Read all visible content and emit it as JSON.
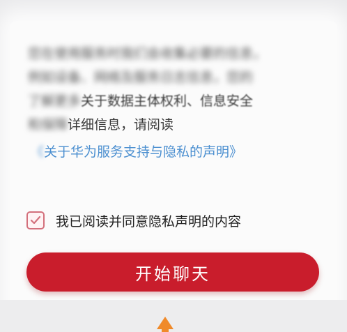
{
  "privacy": {
    "lines": [
      {
        "blur": "您在使用服务时我们会收集必要的信息，",
        "clear": ""
      },
      {
        "blur": "例如设备、网络及服务日志信息，您的",
        "clear": ""
      },
      {
        "blur": "了解更多",
        "clear": "关于数据主体权利、信息安全"
      },
      {
        "blur": "和保障",
        "clear": "详细信息，请阅读"
      }
    ],
    "link_blur": "《",
    "link_clear": "关于华为服务支持与隐私的声明》"
  },
  "consent": {
    "label": "我已阅读并同意隐私声明的内容",
    "checked": true
  },
  "start_button": {
    "label": "开始聊天"
  },
  "colors": {
    "accent": "#c91d2c",
    "link": "#4b8fd0",
    "checkbox_border": "#d3707c",
    "hint_arrow": "#f08a2a"
  }
}
